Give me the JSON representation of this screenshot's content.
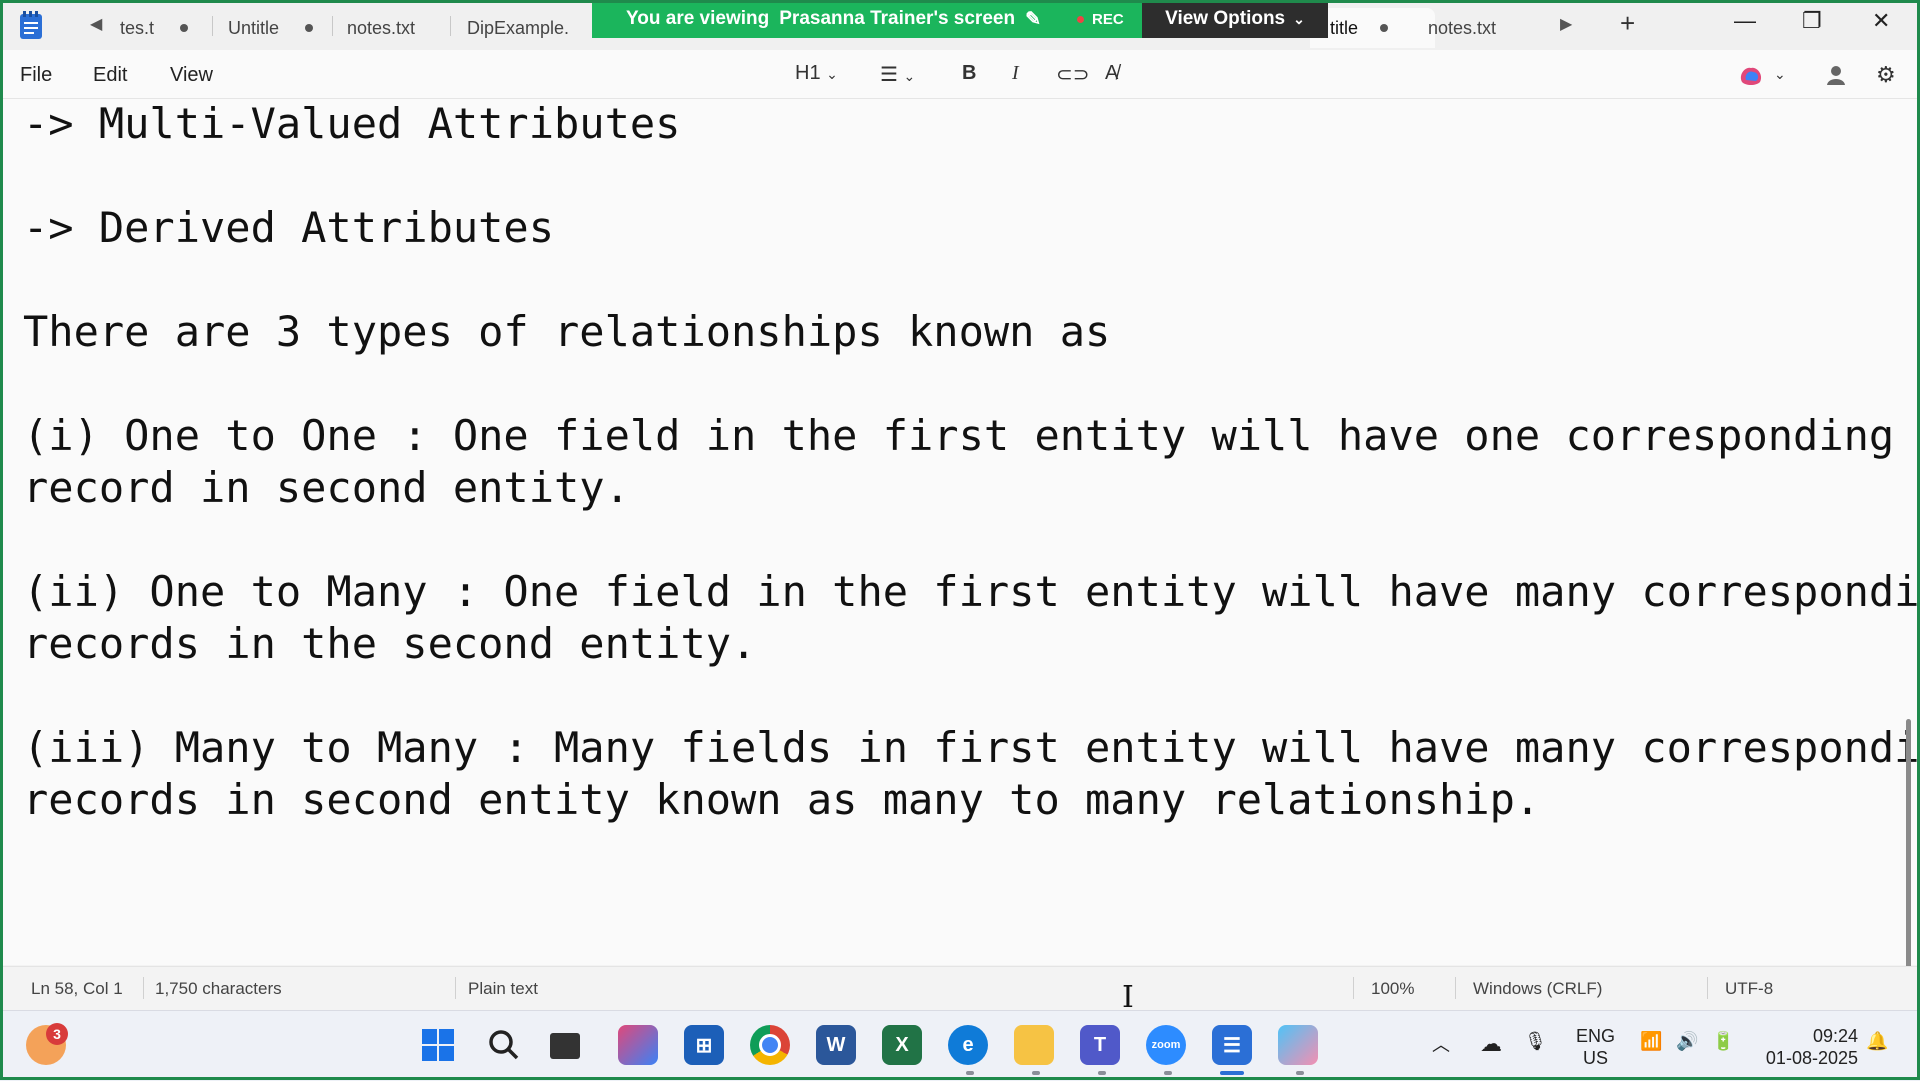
{
  "share_banner": {
    "message": "You are viewing",
    "presenter": "Prasanna Trainer's screen",
    "rec_label": "REC",
    "view_options_label": "View Options"
  },
  "tabs": [
    {
      "label": "tes.t",
      "modified": true
    },
    {
      "label": "Untitle",
      "modified": true
    },
    {
      "label": "notes.txt",
      "modified": false
    },
    {
      "label": "DipExample.",
      "modified": false
    },
    {
      "label": "title",
      "modified": true,
      "active": true
    },
    {
      "label": "notes.txt",
      "modified": false
    }
  ],
  "menu": {
    "file": "File",
    "edit": "Edit",
    "view": "View"
  },
  "toolbar": {
    "heading": "H1"
  },
  "editor": {
    "lines": [
      "-> Multi-Valued Attributes",
      "-> Derived Attributes",
      "There are 3 types of relationships known as",
      "(i) One to One : One field in the first entity will have one corresponding",
      "record in second entity.",
      "(ii) One to Many : One field in the first entity will have many corresponding",
      "records in the second entity.",
      "(iii) Many to Many : Many fields in first entity will have many corresponding",
      "records in second entity known as many to many relationship."
    ]
  },
  "status": {
    "position": "Ln 58, Col 1",
    "characters": "1,750 characters",
    "format": "Plain text",
    "zoom": "100%",
    "line_ending": "Windows (CRLF)",
    "encoding": "UTF-8"
  },
  "taskbar": {
    "notification_count": "3",
    "lang_top": "ENG",
    "lang_bottom": "US",
    "time": "09:24",
    "date": "01-08-2025",
    "zoom_app_label": "zoom"
  },
  "colors": {
    "banner_green": "#1bb55c",
    "view_options_bg": "#2d2d2d",
    "frame_green": "#1f8a4c"
  }
}
